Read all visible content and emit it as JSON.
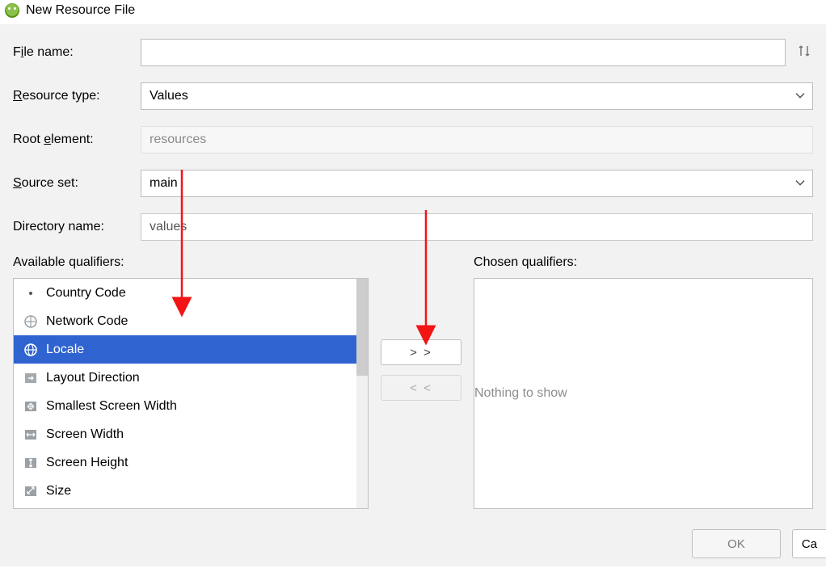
{
  "window": {
    "title": "New Resource File"
  },
  "form": {
    "file_name": {
      "label_pre": "F",
      "label_ul": "i",
      "label_post": "le name:",
      "value": ""
    },
    "resource_type": {
      "label_ul": "R",
      "label_post": "esource type:",
      "value": "Values"
    },
    "root_element": {
      "label_pre": "Root ",
      "label_ul": "e",
      "label_post": "lement:",
      "value": "resources"
    },
    "source_set": {
      "label_ul": "S",
      "label_post": "ource set:",
      "value": "main"
    },
    "directory_name": {
      "label": "Directory name:",
      "value": "values"
    }
  },
  "qualifiers": {
    "available_label_pre": "A",
    "available_label_ul": "v",
    "available_label_post": "ailable qualifiers:",
    "chosen_label_pre": "C",
    "chosen_label_ul": "h",
    "chosen_label_post": "osen qualifiers:",
    "items": [
      {
        "label": "Country Code",
        "icon": "dot",
        "selected": false
      },
      {
        "label": "Network Code",
        "icon": "network",
        "selected": false
      },
      {
        "label": "Locale",
        "icon": "globe",
        "selected": true
      },
      {
        "label": "Layout Direction",
        "icon": "layout",
        "selected": false
      },
      {
        "label": "Smallest Screen Width",
        "icon": "smallest",
        "selected": false
      },
      {
        "label": "Screen Width",
        "icon": "width",
        "selected": false
      },
      {
        "label": "Screen Height",
        "icon": "height",
        "selected": false
      },
      {
        "label": "Size",
        "icon": "size",
        "selected": false
      }
    ],
    "add_label": "> >",
    "remove_label": "< <",
    "chosen_placeholder": "Nothing to show"
  },
  "buttons": {
    "ok": "OK",
    "cancel": "Ca"
  },
  "annot": {
    "arrow1": true,
    "arrow2": true
  }
}
